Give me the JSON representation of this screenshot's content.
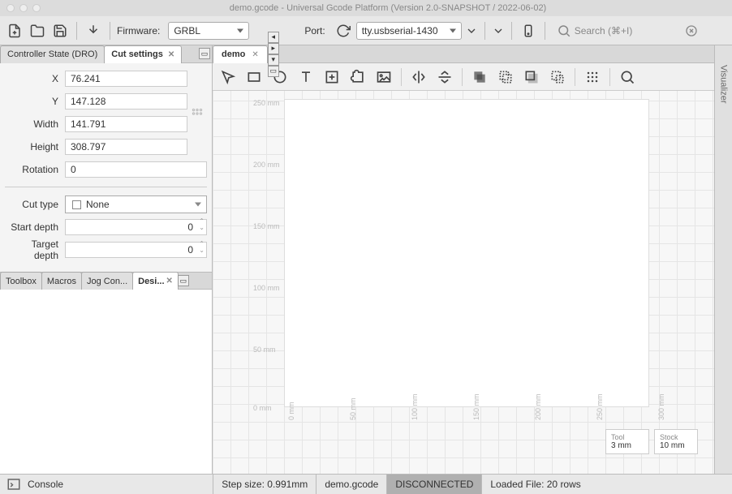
{
  "title": "demo.gcode - Universal Gcode Platform (Version 2.0-SNAPSHOT / 2022-06-02)",
  "toolbar": {
    "firmware_label": "Firmware:",
    "firmware_value": "GRBL",
    "port_label": "Port:",
    "port_value": "tty.usbserial-1430",
    "search_placeholder": "Search (⌘+I)"
  },
  "left_panel": {
    "tabs": {
      "controller_state": "Controller State (DRO)",
      "cut_settings": "Cut settings"
    },
    "props": {
      "x": {
        "label": "X",
        "value": "76.241"
      },
      "y": {
        "label": "Y",
        "value": "147.128"
      },
      "width": {
        "label": "Width",
        "value": "141.791"
      },
      "height": {
        "label": "Height",
        "value": "308.797"
      },
      "rotation": {
        "label": "Rotation",
        "value": "0"
      },
      "cut_type": {
        "label": "Cut type",
        "value": "None"
      },
      "start_depth": {
        "label": "Start depth",
        "value": "0"
      },
      "target_depth": {
        "label": "Target depth",
        "value": "0"
      }
    },
    "lower_tabs": {
      "toolbox": "Toolbox",
      "macros": "Macros",
      "jog": "Jog Con...",
      "designer": "Desi..."
    }
  },
  "document": {
    "tab_name": "demo"
  },
  "canvas": {
    "y_ticks": [
      "250 mm",
      "200 mm",
      "150 mm",
      "100 mm",
      "50 mm",
      "0 mm"
    ],
    "x_ticks": [
      "0 mm",
      "50 mm",
      "100 mm",
      "150 mm",
      "200 mm",
      "250 mm",
      "300 mm"
    ],
    "info": {
      "tool_label": "Tool",
      "tool_value": "3 mm",
      "stock_label": "Stock",
      "stock_value": "10 mm"
    }
  },
  "right_panel": {
    "visualizer": "Visualizer"
  },
  "status": {
    "console": "Console",
    "step_size": "Step size: 0.991mm",
    "filename": "demo.gcode",
    "connection": "DISCONNECTED",
    "loaded": "Loaded File: 20 rows"
  }
}
